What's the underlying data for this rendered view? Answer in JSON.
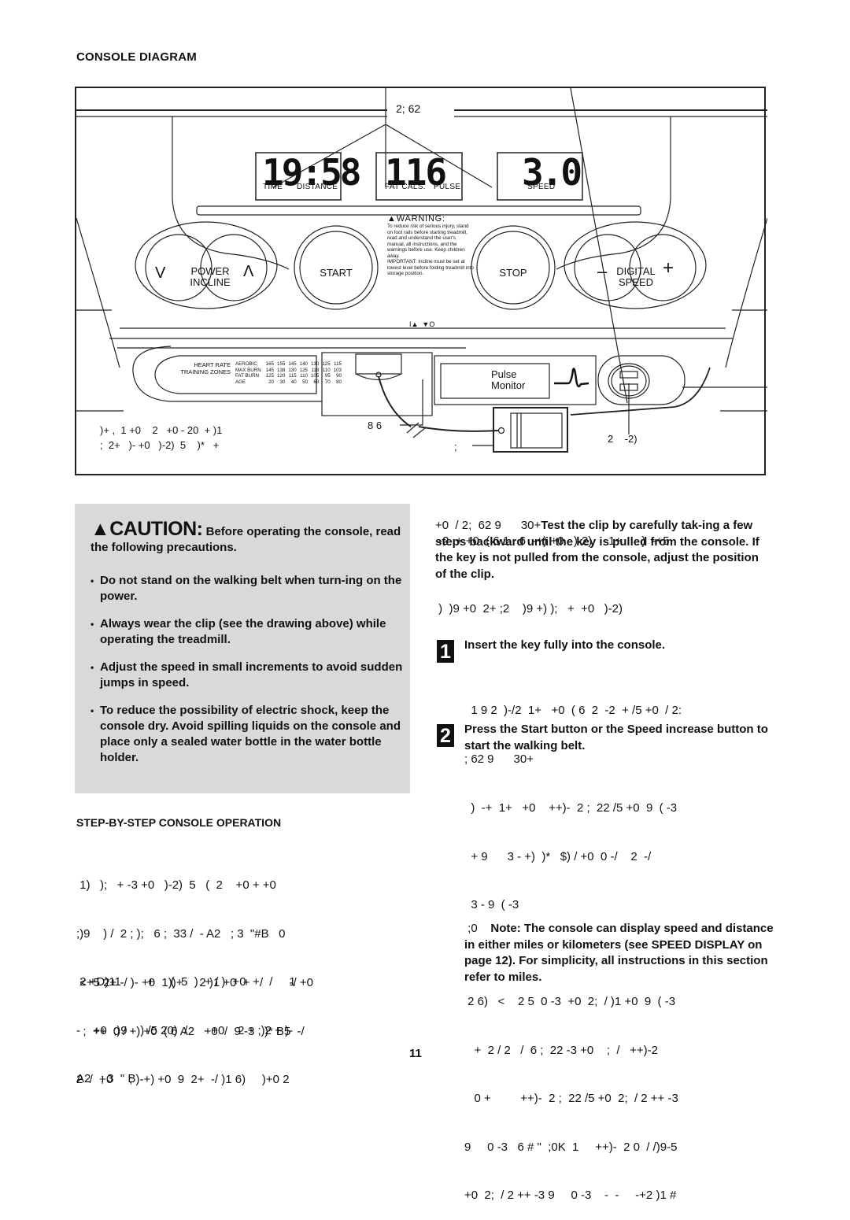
{
  "page": {
    "section_title": "CONSOLE DIAGRAM",
    "page_number": "11"
  },
  "diagram": {
    "callout_display": "2; 62",
    "displays": [
      {
        "value": "19:58",
        "labels": [
          "TIME",
          "DISTANCE"
        ]
      },
      {
        "value": "116",
        "labels": [
          "FAT CALS.",
          "PULSE"
        ]
      },
      {
        "value": "3.0",
        "labels": [
          "SPEED"
        ]
      }
    ],
    "buttons": {
      "incline": {
        "line1": "POWER",
        "line2": "INCLINE",
        "down": "V",
        "up": "Λ"
      },
      "start": "START",
      "stop": "STOP",
      "speed": {
        "line1": "DIGITAL",
        "line2": "SPEED",
        "minus": "–",
        "plus": "+"
      }
    },
    "warning": {
      "title": "WARNING:",
      "text": "To reduce risk of serious injury, stand on foot rails before starting treadmill, read and understand the user's manual, all instructions, and the warnings before use. Keep children away.",
      "important": "IMPORTANT: Incline must be set at lowest level before folding treadmill into storage position."
    },
    "switch_symbols": "I▲  ▼O",
    "heart_rate": {
      "heading_line1": "HEART RATE",
      "heading_line2": "TRAINING ZONES",
      "rows": [
        {
          "label": "AEROBIC",
          "values": [
            "165",
            "155",
            "145",
            "140",
            "130",
            "125",
            "115"
          ]
        },
        {
          "label": "MAX BURN",
          "values": [
            "145",
            "138",
            "130",
            "125",
            "118",
            "110",
            "103"
          ]
        },
        {
          "label": "FAT BURN",
          "values": [
            "125",
            "120",
            "115",
            "110",
            "105",
            "95",
            "90"
          ]
        },
        {
          "label": "AGE",
          "values": [
            "20",
            "30",
            "40",
            "50",
            "60",
            "70",
            "80"
          ]
        }
      ]
    },
    "pulse_monitor": {
      "line1": "Pulse",
      "line2": "Monitor"
    },
    "callouts": {
      "left_line1": ")+ ,  1 +0    2   +0 - 20  + )1",
      "left_line2": ";  2+   )- +0   )-2)  5    )*   +",
      "key": "8 6",
      "clip": ";",
      "sensor": "2    -2)"
    }
  },
  "caution": {
    "word": "CAUTION:",
    "lead": " Before operating the console, read the following precautions.",
    "bullets": [
      "Do not stand on the walking belt when turn-ing on the power.",
      "Always wear the clip (see the drawing above) while operating the treadmill.",
      "Adjust the speed in small increments to avoid sudden jumps in speed.",
      "To reduce the possibility of electric shock, keep the console dry. Avoid spilling liquids on the console and place only a sealed water bottle in the water bottle holder."
    ]
  },
  "operation": {
    "heading": "STEP-BY-STEP CONSOLE OPERATION",
    "para1": [
      " 1)   );   + -3 +0   )-2)  5   (  2    +0 + +0",
      ";)9    ) /  2 ; );   6 ;  33 /  - A2   ; 3  \"#B   0",
      " 2 +D)11        +     (  5  )  + / )- +0  +   /     1",
      "-    +0  ;)9    ) /5 20)  /     - +0    2 + ;)2 + )-",
      "A2   ; 3  \" B"
    ],
    "para2": [
      " <+5 2+ -/ )- +0  1))+     2 )1 +0  +   /        -/ +0",
      "  ;  ++  0 / +) +0  ( 6 A2   +0  /  9 -3   )* B5  -/",
      "2  /  +0     ; )-+) +0  9  2+  -/ )1 6)     )+0 2"
    ]
  },
  "right_column": {
    "clip_para_garbled": [
      " -2  + +0  ( 6 1   6  -+) +0   )-2)     1+      )  -+5",
      "+0  / 2;  62 9      30+"
    ],
    "clip_para_bold": "Test the clip by carefully tak-ing a few steps backward until the key is pulled from the console. If the key is not pulled from the console, adjust the position of the clip.",
    "line_after": " )  )9 +0  2+ ;2    )9 +) );   +  +0   )-2)",
    "steps": [
      {
        "number": "1",
        "title": "Insert the key fully into the console.",
        "body": [
          "  1 9 2  )-/2  1+   +0  ( 6  2  -2  + /5 +0  / 2:",
          "; 62 9      30+"
        ]
      },
      {
        "number": "2",
        "title": "Press the Start button or the Speed increase button to start the walking belt.",
        "body": [
          "  )  -+  1+   +0    ++)-  2 ;  22 /5 +0  9  ( -3",
          "  + 9      3 - +)  )*   $) / +0  0 -/    2  -/",
          "  3 - 9  ( -3",
          "",
          " 2 6)   <    2 5  0 -3  +0  2;  / )1 +0  9  ( -3",
          "   +  2 / 2   /  6 ;  22 -3 +0    ;  /   ++)-2",
          "   0 +         ++)-  2 ;  22 /5 +0  2;  / 2 ++ -3",
          "9     0 -3   6 # \"  ;0K  1     ++)-  2 0  / /)9-5",
          "+0  2;  / 2 ++ -3 9     0 -3    -  -     -+2 )1 #"
        ],
        "note_prefix": " ;0    ",
        "note": "Note: The console can display speed and distance in either miles or kilometers (see SPEED DISPLAY on page 12). For simplicity, all instructions in this section refer to miles."
      }
    ]
  }
}
